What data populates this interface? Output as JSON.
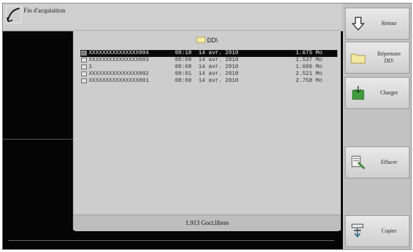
{
  "header": {
    "title": "Fin d'acquisition"
  },
  "dialog": {
    "path": "DD\\",
    "files": [
      {
        "name": "XXXXXXXXXXXXXXX004",
        "time": "08:10",
        "date": "14 avr. 2010",
        "size": "1.675 Mo",
        "selected": true
      },
      {
        "name": "XXXXXXXXXXXXXXX003",
        "time": "08:09",
        "date": "14 avr. 2010",
        "size": "1.537 Mo",
        "selected": false
      },
      {
        "name": "1",
        "time": "08:08",
        "date": "14 avr. 2010",
        "size": "1.606 Mo",
        "selected": false
      },
      {
        "name": "XXXXXXXXXXXXXXX002",
        "time": "08:01",
        "date": "14 avr. 2010",
        "size": "2.521 Mo",
        "selected": false
      },
      {
        "name": "XXXXXXXXXXXXXXX001",
        "time": "08:00",
        "date": "14 avr. 2010",
        "size": "2.758 Mo",
        "selected": false
      }
    ],
    "free_space": "1.913 Goct.libres"
  },
  "panel": {
    "buttons": [
      {
        "label": "Retour",
        "icon": "arrow-down-icon"
      },
      {
        "label": "Répertoire\nDD\\",
        "icon": "folder-icon"
      },
      {
        "label": "Charger",
        "icon": "load-icon"
      },
      {
        "label": "Effacer",
        "icon": "erase-icon"
      },
      {
        "label": "Copier",
        "icon": "copy-icon"
      }
    ]
  },
  "colors": {
    "selection": "#0a0a0a",
    "background": "#c9c9c9",
    "dark": "#050505"
  }
}
